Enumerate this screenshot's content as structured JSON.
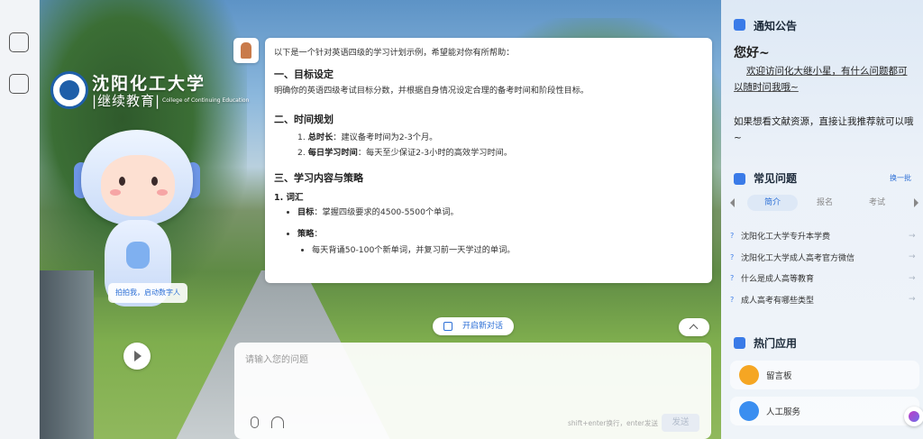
{
  "logo": {
    "name": "沈阳化工大学",
    "division": "|继续教育|",
    "english": "College of Continuing Education"
  },
  "mascot": {
    "badge_label": "拍拍我，启动数字人"
  },
  "chat": {
    "intro": "以下是一个针对英语四级的学习计划示例，希望能对你有所帮助：",
    "section1": {
      "title": "一、目标设定",
      "text": "明确你的英语四级考试目标分数，并根据自身情况设定合理的备考时间和阶段性目标。"
    },
    "section2": {
      "title": "二、时间规划",
      "items": [
        {
          "num": "1.",
          "bold": "总时长",
          "text": "：建议备考时间为2-3个月。"
        },
        {
          "num": "2.",
          "bold": "每日学习时间",
          "text": "：每天至少保证2-3小时的高效学习时间。"
        }
      ]
    },
    "section3": {
      "title": "三、学习内容与策略",
      "sub1_title": "1. 词汇",
      "goal_bold": "目标",
      "goal_text": "：掌握四级要求的4500-5500个单词。",
      "strategy_bold": "策略",
      "strategy_text": "：",
      "strategy_item": "每天背诵50-100个新单词，并复习前一天学过的单词。"
    },
    "new_chat_label": "开启新对话",
    "input_placeholder": "请输入您的问题",
    "hint": "shift+enter换行，enter发送",
    "send_label": "发送"
  },
  "right_panel": {
    "notice_title": "通知公告",
    "hello": "您好~",
    "welcome": "欢迎访问化大继小星，有什么问题都可以随时问我哦~",
    "recommend": "如果想看文献资源，直接让我推荐就可以哦~",
    "faq_title": "常见问题",
    "swap_label": "换一批",
    "tabs": [
      "简介",
      "报名",
      "考试"
    ],
    "questions": [
      "沈阳化工大学专升本学费",
      "沈阳化工大学成人高考官方微信",
      "什么是成人高等教育",
      "成人高考有哪些类型"
    ],
    "apps_title": "热门应用",
    "apps": [
      {
        "label": "留言板",
        "color": "#f5a623"
      },
      {
        "label": "人工服务",
        "color": "#3a8ef0"
      }
    ]
  },
  "colors": {
    "accent": "#2c6fd6",
    "panel_bg": "#eef3f9"
  }
}
